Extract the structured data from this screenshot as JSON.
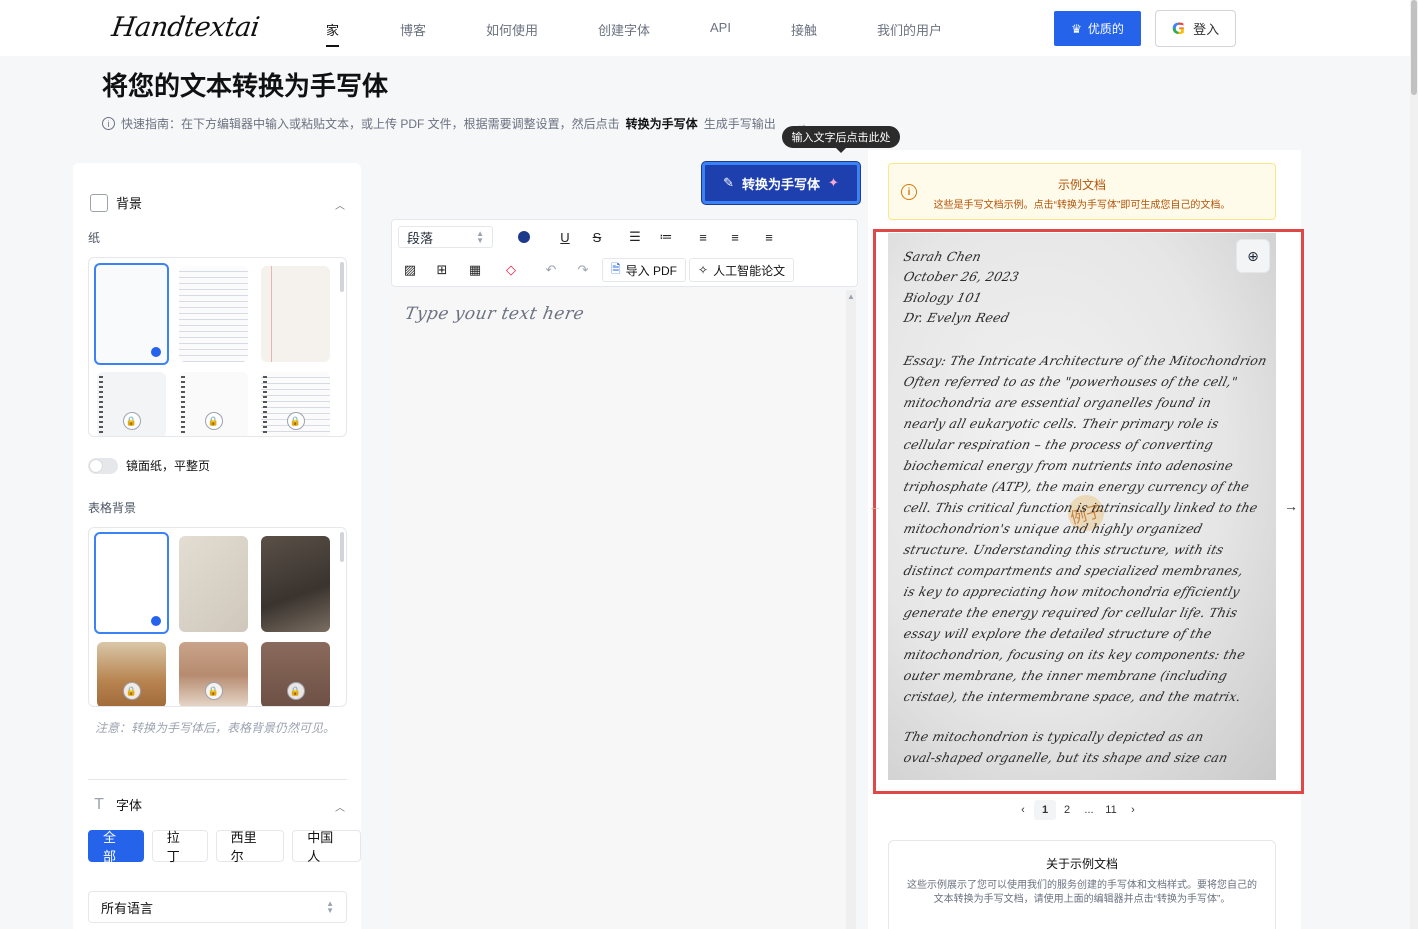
{
  "header": {
    "logo": "Handtextai",
    "nav": [
      "家",
      "博客",
      "如何使用",
      "创建字体",
      "API",
      "接触",
      "我们的用户"
    ],
    "premium_label": "优质的",
    "login_label": "登入"
  },
  "hero": {
    "title": "将您的文本转换为手写体",
    "guide_prefix": "快速指南：在下方编辑器中输入或粘贴文本，或上传 PDF 文件，根据需要调整设置，然后点击",
    "guide_bold": "转换为手写体",
    "guide_suffix": "生成手写输出",
    "tooltip": "输入文字后点击此处"
  },
  "left": {
    "background_section": "背景",
    "paper_label": "纸",
    "mirror_label": "镜面纸，平整页",
    "table_bg_label": "表格背景",
    "note": "注意：转换为手写体后，表格背景仍然可见。",
    "font_section": "字体",
    "font_tabs": [
      "全部",
      "拉丁",
      "西里尔",
      "中国人"
    ],
    "language_select": "所有语言"
  },
  "editor": {
    "convert_label": "转换为手写体",
    "paragraph_select": "段落",
    "import_pdf": "导入 PDF",
    "ai_essay": "人工智能论文",
    "placeholder": "Type your text here"
  },
  "right": {
    "notice_title": "示例文档",
    "notice_text": "这些是手写文档示例。点击“转换为手写体”即可生成您自己的文档。",
    "stamp": "例子",
    "handwriting_lines": [
      "Sarah Chen",
      "October 26, 2023",
      "Biology 101",
      "Dr. Evelyn Reed",
      "Essay: The Intricate Architecture of the Mitochondrion",
      "Often referred to as the \"powerhouses of the cell,\"",
      "mitochondria are essential organelles found in",
      "nearly all eukaryotic cells. Their primary role is",
      "cellular respiration – the process of converting",
      "biochemical energy from nutrients into adenosine",
      "triphosphate (ATP), the main energy currency of the",
      "cell. This critical function is intrinsically linked to the",
      "mitochondrion's unique and highly organized",
      "structure. Understanding this structure, with its",
      "distinct compartments and specialized membranes,",
      "is key to appreciating how mitochondria efficiently",
      "generate the energy required for cellular life. This",
      "essay will explore the detailed structure of the",
      "mitochondrion, focusing on its key components: the",
      "outer membrane, the inner membrane (including",
      "cristae), the intermembrane space, and the matrix.",
      "The mitochondrion is typically depicted as an",
      "oval-shaped organelle, but its shape and size can"
    ],
    "pager": [
      "1",
      "2",
      "...",
      "11"
    ],
    "about_title": "关于示例文档",
    "about_text": "这些示例展示了您可以使用我们的服务创建的手写体和文档样式。要将您自己的文本转换为手写文档，请使用上面的编辑器并点击“转换为手写体”。"
  }
}
